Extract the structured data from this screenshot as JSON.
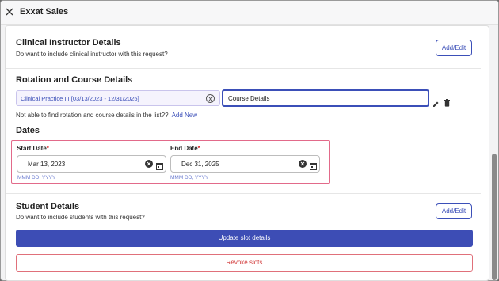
{
  "window": {
    "title": "Exxat Sales"
  },
  "clinical_instructor": {
    "title": "Clinical Instructor Details",
    "subtitle": "Do want to include clinical instructor with this request?",
    "button_label": "Add/Edit"
  },
  "rotation": {
    "title": "Rotation and Course Details",
    "selected_rotation": "Clinical Practice III [03/13/2023 - 12/31/2025]",
    "course_input_value": "Course Details",
    "not_found_text": "Not able to find rotation and course details in the list??",
    "add_new_label": "Add New"
  },
  "dates": {
    "title": "Dates",
    "start_label": "Start Date",
    "start_value": "Mar 13, 2023",
    "start_hint": "MMM DD, YYYY",
    "end_label": "End Date",
    "end_value": "Dec 31, 2025",
    "end_hint": "MMM DD, YYYY",
    "required_mark": "*"
  },
  "student": {
    "title": "Student Details",
    "subtitle": "Do want to include students with this request?",
    "button_label": "Add/Edit"
  },
  "actions": {
    "update_label": "Update slot details",
    "revoke_label": "Revoke slots"
  },
  "colors": {
    "accent": "#3b4fb8",
    "danger": "#d23b3b",
    "highlight_border": "#e26a8a"
  },
  "icons": {
    "close": "close-icon",
    "clear": "clear-circle-icon",
    "edit": "pencil-icon",
    "delete": "trash-icon",
    "calendar": "calendar-icon"
  }
}
